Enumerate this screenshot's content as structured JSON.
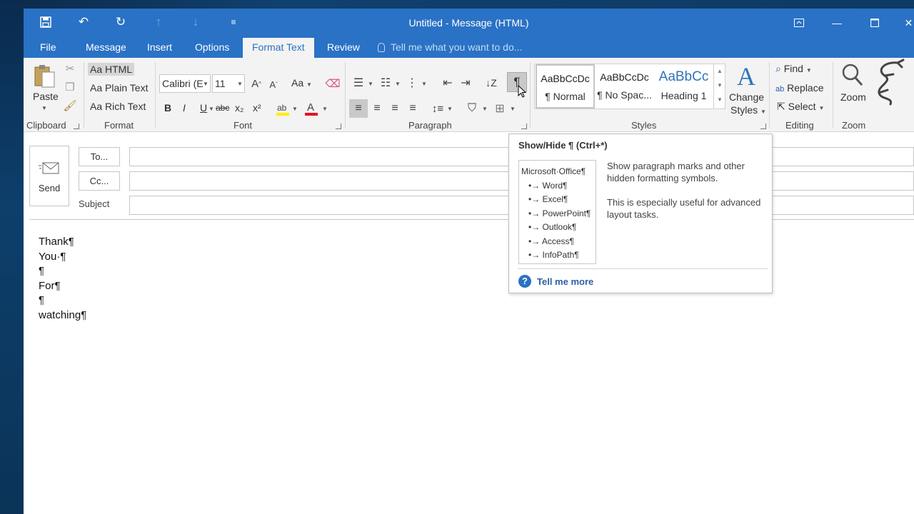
{
  "window": {
    "title": "Untitled - Message (HTML)"
  },
  "tabs": [
    "File",
    "Message",
    "Insert",
    "Options",
    "Format Text",
    "Review"
  ],
  "tell_me": "Tell me what you want to do...",
  "clipboard": {
    "paste": "Paste",
    "label": "Clipboard"
  },
  "format": {
    "html": "Aa HTML",
    "plain": "Aa Plain Text",
    "rich": "Aa Rich Text",
    "label": "Format"
  },
  "font": {
    "name": "Calibri (E",
    "size": "11",
    "case": "Aa",
    "bold": "B",
    "italic": "I",
    "underline": "U",
    "strike": "abc",
    "subscript": "x₂",
    "superscript": "x²",
    "label": "Font"
  },
  "paragraph": {
    "label": "Paragraph",
    "pilcrow": "¶"
  },
  "styles": {
    "items": [
      {
        "sample": "AaBbCcDc",
        "name": "¶ Normal"
      },
      {
        "sample": "AaBbCcDc",
        "name": "¶ No Spac..."
      },
      {
        "sample": "AaBbCc",
        "name": "Heading 1"
      }
    ],
    "change_line1": "Change",
    "change_line2": "Styles",
    "label": "Styles"
  },
  "editing": {
    "find": "Find",
    "replace": "Replace",
    "select": "Select",
    "label": "Editing"
  },
  "zoom": {
    "button": "Zoom",
    "label": "Zoom"
  },
  "header": {
    "send": "Send",
    "to": "To...",
    "cc": "Cc...",
    "subject": "Subject"
  },
  "body_lines": [
    "Thank¶",
    "You·¶",
    "¶",
    "For¶",
    "¶",
    "watching¶"
  ],
  "tooltip": {
    "title": "Show/Hide ¶ (Ctrl+*)",
    "preview_root": "Microsoft·Office¶",
    "preview_items": [
      "•→ Word¶",
      "•→ Excel¶",
      "•→ PowerPoint¶",
      "•→ Outlook¶",
      "•→ Access¶",
      "•→ InfoPath¶"
    ],
    "desc1": "Show paragraph marks and other hidden formatting symbols.",
    "desc2": "This is especially useful for advanced layout tasks.",
    "more": "Tell me more"
  },
  "colors": {
    "accent": "#2a72c5",
    "highlight": "#ffee00",
    "font_color": "#e81123"
  }
}
